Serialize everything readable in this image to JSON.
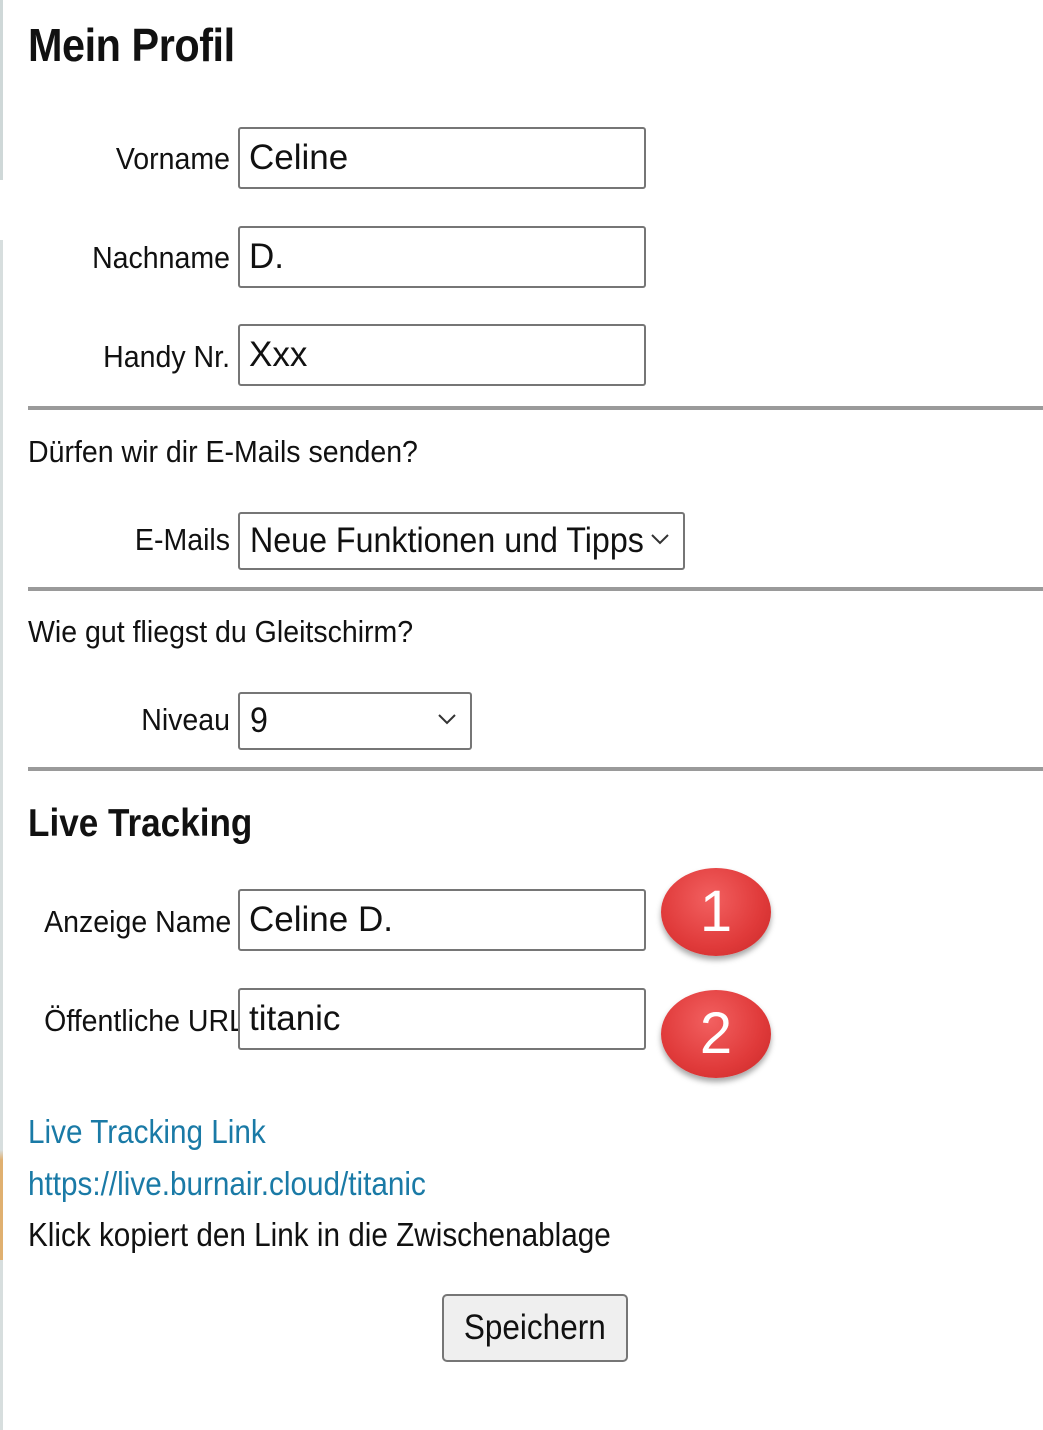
{
  "page": {
    "title": "Mein Profil"
  },
  "profile": {
    "vorname_label": "Vorname",
    "vorname_value": "Celine",
    "nachname_label": "Nachname",
    "nachname_value": "D.",
    "handy_label": "Handy Nr.",
    "handy_value": "Xxx"
  },
  "emails": {
    "question": "Dürfen wir dir E-Mails senden?",
    "label": "E-Mails",
    "selected": "Neue Funktionen und Tipps"
  },
  "level": {
    "question": "Wie gut fliegst du Gleitschirm?",
    "label": "Niveau",
    "selected": "9"
  },
  "live_tracking": {
    "heading": "Live Tracking",
    "display_name_label": "Anzeige Name",
    "display_name_value": "Celine D.",
    "public_url_label": "Öffentliche URL",
    "public_url_value": "titanic",
    "link_label": "Live Tracking Link",
    "link_url": "https://live.burnair.cloud/titanic",
    "hint": "Klick kopiert den Link in die Zwischenablage"
  },
  "annotations": {
    "badge_1": "1",
    "badge_2": "2",
    "badge_color": "#e03a3a"
  },
  "actions": {
    "save_label": "Speichern"
  },
  "colors": {
    "link": "#1a7aa6",
    "divider": "#9a9a9a"
  }
}
